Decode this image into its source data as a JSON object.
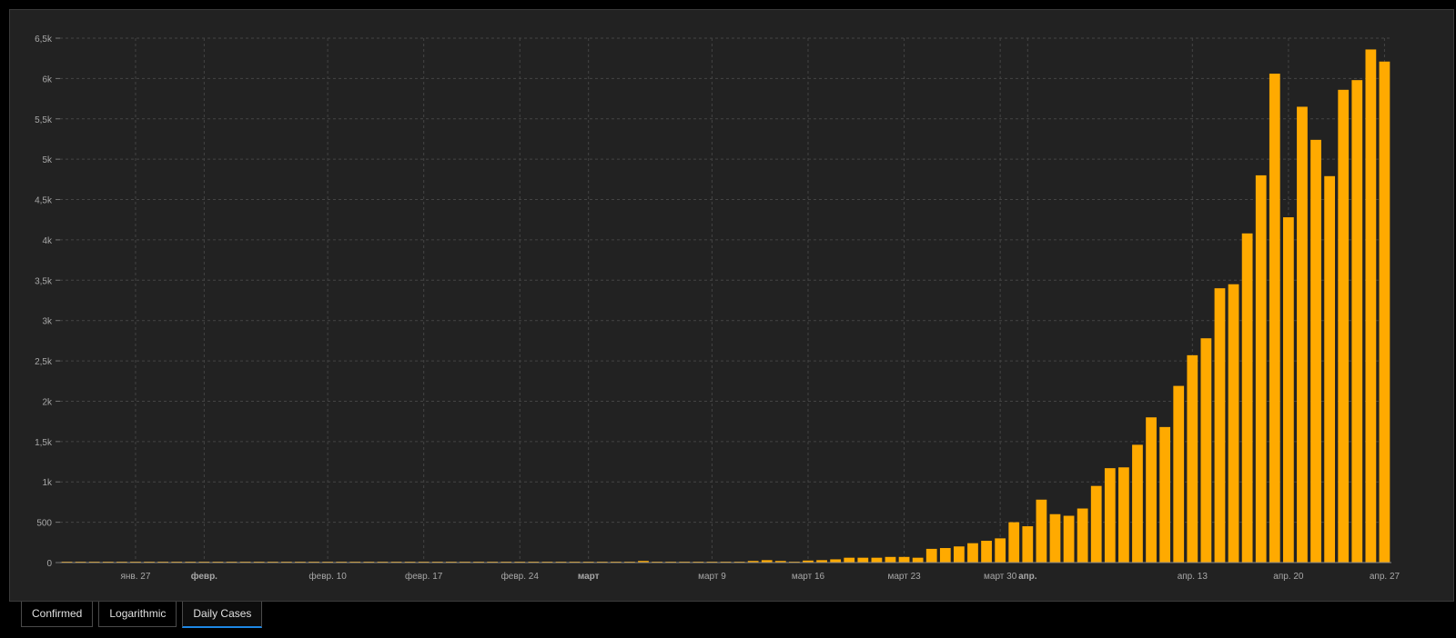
{
  "tabs": [
    {
      "label": "Confirmed",
      "active": false
    },
    {
      "label": "Logarithmic",
      "active": false
    },
    {
      "label": "Daily Cases",
      "active": true
    }
  ],
  "colors": {
    "bar": "#ffaa00",
    "background": "#222222",
    "grid": "#444444",
    "tab_active_underline": "#1e88e5"
  },
  "chart_data": {
    "type": "bar",
    "title": "",
    "xlabel": "",
    "ylabel": "",
    "ylim": [
      0,
      6500
    ],
    "grid": true,
    "y_ticks": [
      {
        "value": 0,
        "label": "0"
      },
      {
        "value": 500,
        "label": "500"
      },
      {
        "value": 1000,
        "label": "1k"
      },
      {
        "value": 1500,
        "label": "1,5k"
      },
      {
        "value": 2000,
        "label": "2k"
      },
      {
        "value": 2500,
        "label": "2,5k"
      },
      {
        "value": 3000,
        "label": "3k"
      },
      {
        "value": 3500,
        "label": "3,5k"
      },
      {
        "value": 4000,
        "label": "4k"
      },
      {
        "value": 4500,
        "label": "4,5k"
      },
      {
        "value": 5000,
        "label": "5k"
      },
      {
        "value": 5500,
        "label": "5,5k"
      },
      {
        "value": 6000,
        "label": "6k"
      },
      {
        "value": 6500,
        "label": "6,5k"
      }
    ],
    "x_ticks": [
      {
        "index": 5,
        "label": "янв. 27",
        "bold": false
      },
      {
        "index": 10,
        "label": "февр.",
        "bold": true
      },
      {
        "index": 19,
        "label": "февр. 10",
        "bold": false
      },
      {
        "index": 26,
        "label": "февр. 17",
        "bold": false
      },
      {
        "index": 33,
        "label": "февр. 24",
        "bold": false
      },
      {
        "index": 38,
        "label": "март",
        "bold": true
      },
      {
        "index": 47,
        "label": "март 9",
        "bold": false
      },
      {
        "index": 54,
        "label": "март 16",
        "bold": false
      },
      {
        "index": 61,
        "label": "март 23",
        "bold": false
      },
      {
        "index": 68,
        "label": "март 30",
        "bold": false
      },
      {
        "index": 70,
        "label": "апр.",
        "bold": true
      },
      {
        "index": 82,
        "label": "апр. 13",
        "bold": false
      },
      {
        "index": 89,
        "label": "апр. 20",
        "bold": false
      },
      {
        "index": 96,
        "label": "апр. 27",
        "bold": false
      }
    ],
    "start_date": "2020-01-22",
    "values": [
      0,
      0,
      0,
      0,
      0,
      0,
      0,
      0,
      0,
      0,
      0,
      0,
      0,
      0,
      0,
      0,
      0,
      0,
      0,
      0,
      0,
      0,
      0,
      0,
      0,
      0,
      0,
      0,
      0,
      0,
      0,
      0,
      0,
      0,
      0,
      0,
      0,
      0,
      0,
      0,
      0,
      0,
      20,
      0,
      0,
      0,
      0,
      0,
      0,
      0,
      20,
      30,
      20,
      0,
      25,
      30,
      40,
      60,
      60,
      60,
      70,
      70,
      60,
      170,
      180,
      200,
      240,
      270,
      300,
      500,
      450,
      780,
      600,
      580,
      670,
      950,
      1170,
      1180,
      1460,
      1800,
      1680,
      2190,
      2570,
      2780,
      3400,
      3450,
      4080,
      4800,
      6060,
      4280,
      5650,
      5240,
      4790,
      5860,
      5980,
      6360,
      6210
    ]
  }
}
